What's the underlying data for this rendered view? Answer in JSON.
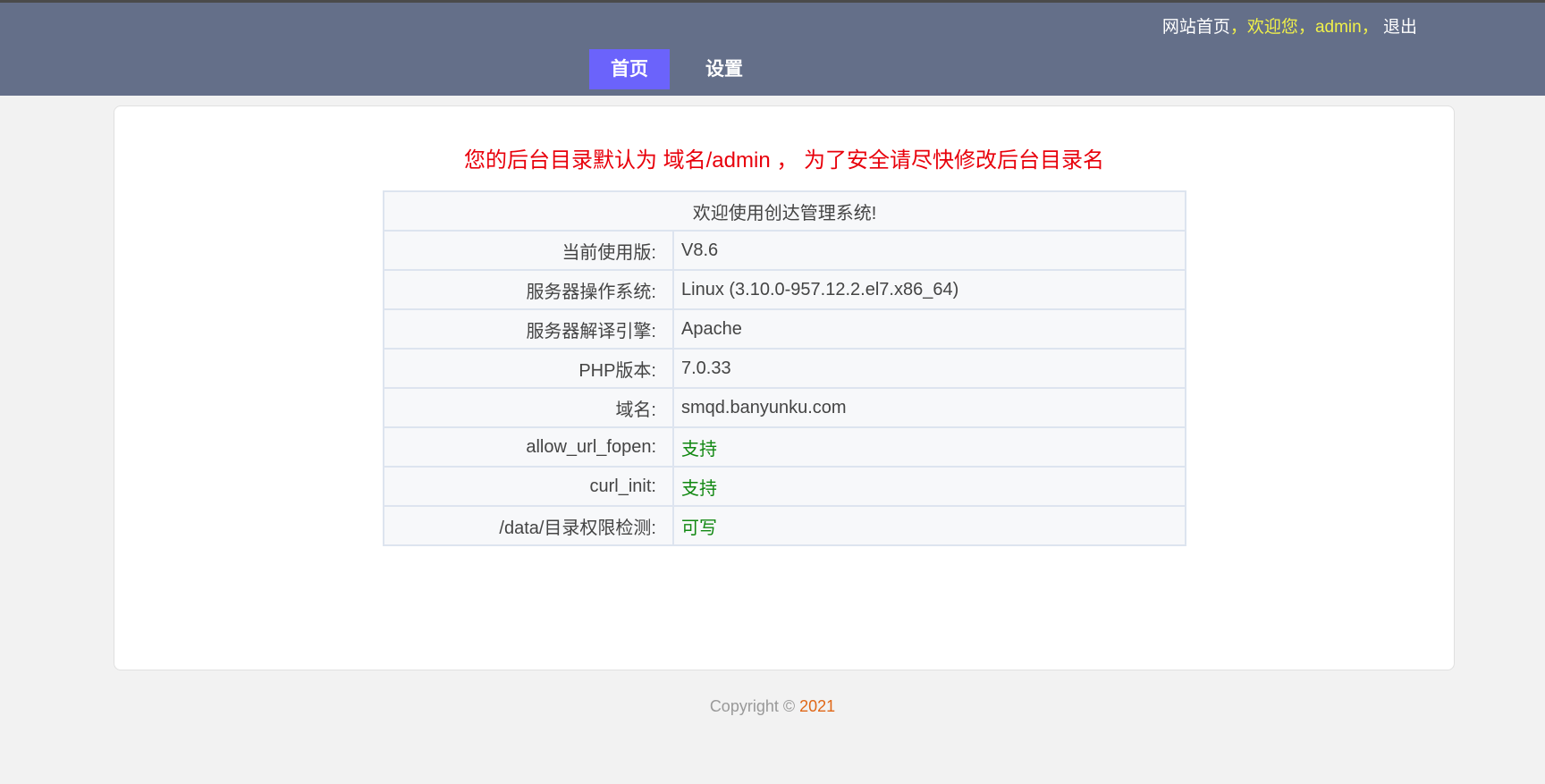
{
  "header": {
    "home_link": "网站首页",
    "sep1": "，",
    "welcome": "欢迎您，",
    "user": "admin",
    "sep2": "，",
    "logout": "退出",
    "nav": [
      {
        "label": "首页",
        "active": true
      },
      {
        "label": "设置",
        "active": false
      }
    ]
  },
  "main": {
    "warning": "您的后台目录默认为 域名/admin ， 为了安全请尽快修改后台目录名",
    "table_title": "欢迎使用创达管理系统!",
    "rows": [
      {
        "label": "当前使用版:",
        "value": "V8.6"
      },
      {
        "label": "服务器操作系统:",
        "value": "Linux (3.10.0-957.12.2.el7.x86_64)"
      },
      {
        "label": "服务器解译引擎:",
        "value": "Apache"
      },
      {
        "label": "PHP版本:",
        "value": "7.0.33"
      },
      {
        "label": "域名:",
        "value": "smqd.banyunku.com"
      },
      {
        "label": "allow_url_fopen:",
        "value": "支持"
      },
      {
        "label": "curl_init:",
        "value": "支持"
      },
      {
        "label": "/data/目录权限检测:",
        "value": "可写"
      }
    ]
  },
  "footer": {
    "copyright": "Copyright © ",
    "year": "2021"
  },
  "colors": {
    "header": "#646f89",
    "active_nav": "#6b63fb",
    "warning": "#e8000b",
    "ok": "#118811"
  }
}
